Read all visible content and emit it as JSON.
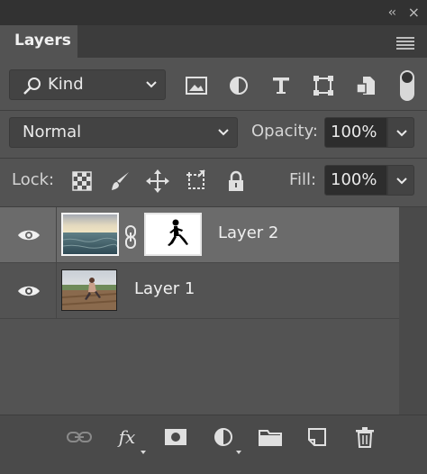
{
  "window": {
    "collapse_icon": "double-chevron-left-icon",
    "close_icon": "close-icon"
  },
  "panel": {
    "title": "Layers",
    "menu_icon": "hamburger-menu-icon"
  },
  "filter": {
    "kind_label": "Kind",
    "icons": [
      "image-filter-icon",
      "adjustment-filter-icon",
      "type-filter-icon",
      "shape-filter-icon",
      "smart-object-filter-icon"
    ]
  },
  "blend": {
    "mode": "Normal",
    "opacity_label": "Opacity:",
    "opacity_value": "100%"
  },
  "lock": {
    "label": "Lock:",
    "icons": [
      "lock-transparent-pixels-icon",
      "lock-image-pixels-icon",
      "lock-position-icon",
      "lock-artboards-icon",
      "lock-all-icon"
    ],
    "fill_label": "Fill:",
    "fill_value": "100%"
  },
  "layers": [
    {
      "name": "Layer 2",
      "visible": true,
      "selected": true,
      "has_mask": true
    },
    {
      "name": "Layer 1",
      "visible": true,
      "selected": false,
      "has_mask": false
    }
  ],
  "bottom_icons": [
    "link-layers-icon",
    "fx-icon",
    "add-mask-icon",
    "adjustment-layer-icon",
    "group-folder-icon",
    "new-layer-icon",
    "trash-icon"
  ],
  "colors": {
    "panel_bg": "#535353",
    "selected_row": "#6b6b6b",
    "field_dark": "#2d2d2d"
  }
}
